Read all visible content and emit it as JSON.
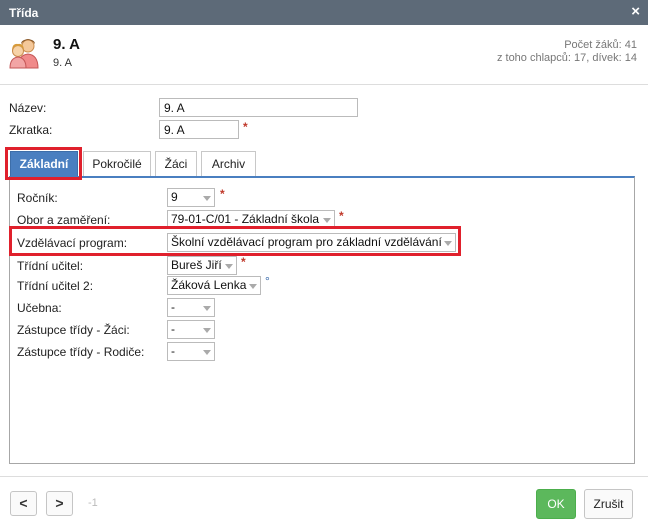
{
  "window": {
    "title": "Třída",
    "close_icon": "×"
  },
  "header": {
    "title": "9. A",
    "subtitle": "9. A",
    "stats_line1": "Počet žáků: 41",
    "stats_line2": "z toho chlapců: 17, dívek: 14"
  },
  "form": {
    "name_label": "Název:",
    "name_value": "9. A",
    "abbr_label": "Zkratka:",
    "abbr_value": "9. A",
    "required_mark": "*"
  },
  "tabs": [
    {
      "label": "Základní",
      "active": true
    },
    {
      "label": "Pokročilé",
      "active": false
    },
    {
      "label": "Žáci",
      "active": false
    },
    {
      "label": "Archiv",
      "active": false
    }
  ],
  "fields": {
    "rocnik_label": "Ročník:",
    "rocnik_value": "9",
    "obor_label": "Obor a zaměření:",
    "obor_value": "79-01-C/01 - Základní škola",
    "program_label": "Vzdělávací program:",
    "program_value": "Školní vzdělávací program pro základní vzdělávání",
    "ucitel_label": "Třídní učitel:",
    "ucitel_value": "Bureš Jiří",
    "ucitel2_label": "Třídní učitel 2:",
    "ucitel2_value": "Žáková Lenka",
    "ucitel2_mark": "°",
    "ucebna_label": "Učebna:",
    "ucebna_value": "-",
    "zastupce_zaci_label": "Zástupce třídy - Žáci:",
    "zastupce_zaci_value": "-",
    "zastupce_rodice_label": "Zástupce třídy - Rodiče:",
    "zastupce_rodice_value": "-"
  },
  "footer": {
    "prev_label": "<",
    "next_label": ">",
    "counter": "-1",
    "ok_label": "OK",
    "cancel_label": "Zrušit"
  },
  "colors": {
    "titlebar": "#5d6a78",
    "tab_active": "#4a7fc0",
    "ok": "#5cb85c",
    "highlight": "#e0202c",
    "required": "#c0392b"
  }
}
